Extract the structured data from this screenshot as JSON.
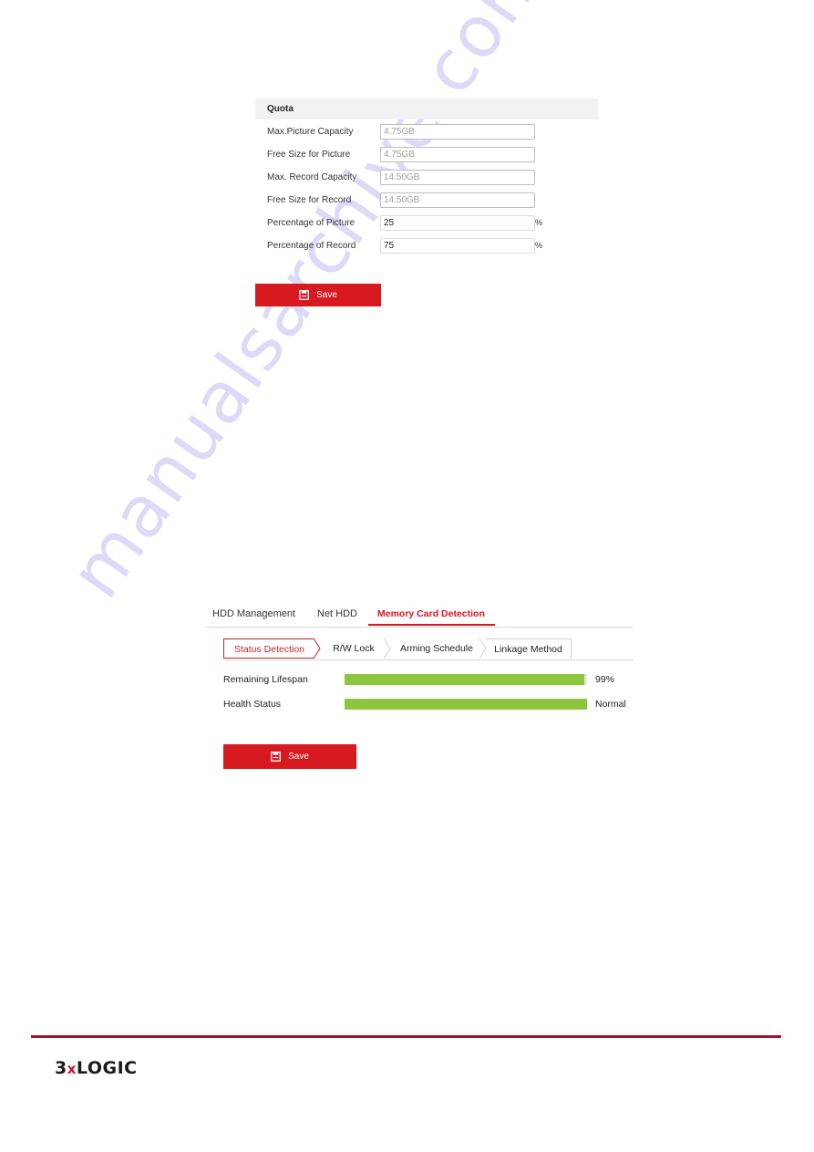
{
  "watermark": "manualsarchive.com",
  "quota": {
    "header": "Quota",
    "rows": [
      {
        "label": "Max.Picture Capacity",
        "value": "4.75GB",
        "editable": false,
        "unit": ""
      },
      {
        "label": "Free Size for Picture",
        "value": "4.75GB",
        "editable": false,
        "unit": ""
      },
      {
        "label": "Max. Record Capacity",
        "value": "14.50GB",
        "editable": false,
        "unit": ""
      },
      {
        "label": "Free Size for Record",
        "value": "14.50GB",
        "editable": false,
        "unit": ""
      },
      {
        "label": "Percentage of Picture",
        "value": "25",
        "editable": true,
        "unit": "%"
      },
      {
        "label": "Percentage of Record",
        "value": "75",
        "editable": true,
        "unit": "%"
      }
    ],
    "save_label": "Save"
  },
  "memory_card": {
    "tabs": [
      {
        "label": "HDD Management",
        "active": false
      },
      {
        "label": "Net HDD",
        "active": false
      },
      {
        "label": "Memory Card Detection",
        "active": true
      }
    ],
    "subtabs": [
      {
        "label": "Status Detection",
        "active": true
      },
      {
        "label": "R/W Lock",
        "active": false
      },
      {
        "label": "Arming Schedule",
        "active": false
      },
      {
        "label": "Linkage Method",
        "active": false
      }
    ],
    "stats": [
      {
        "label": "Remaining Lifespan",
        "fill_percent": 99,
        "value": "99%"
      },
      {
        "label": "Health Status",
        "fill_percent": 100,
        "value": "Normal"
      }
    ],
    "save_label": "Save",
    "colors": {
      "accent": "#d71920",
      "bar": "#8cc63f"
    }
  },
  "footer": {
    "logo_prefix": "3",
    "logo_x": "x",
    "logo_suffix": "LOGIC",
    "line_color": "#a3112e"
  }
}
